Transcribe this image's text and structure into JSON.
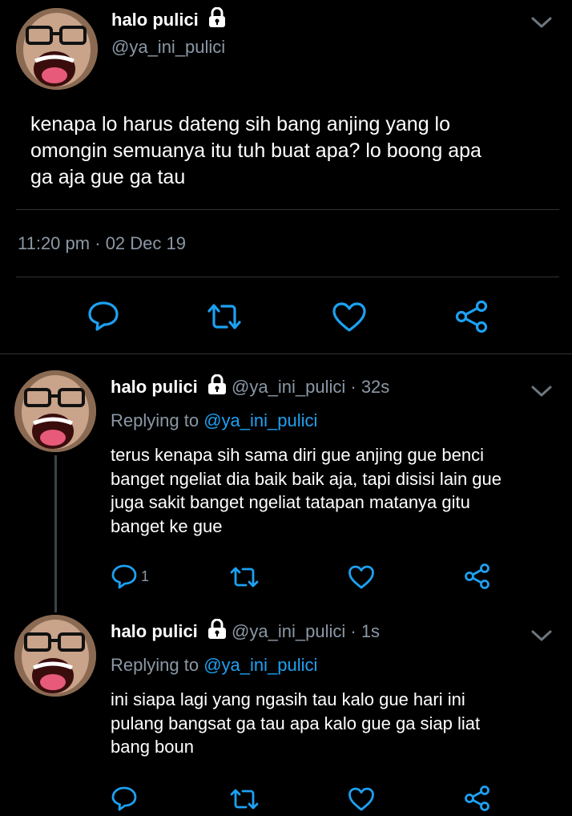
{
  "main_tweet": {
    "display_name": "halo pulici",
    "handle": "@ya_ini_pulici",
    "text_lines": [
      "kenapa lo harus dateng sih bang anjing yang lo",
      "omongin semuanya itu tuh buat apa? lo boong apa",
      "ga aja gue ga tau"
    ],
    "timestamp": "11:20 pm",
    "separator": "·",
    "date": "02 Dec 19"
  },
  "replies": [
    {
      "display_name": "halo pulici",
      "handle": "@ya_ini_pulici",
      "separator": "·",
      "age": "32s",
      "replying_prefix": "Replying to",
      "replying_to": "@ya_ini_pulici",
      "text_lines": [
        "terus kenapa sih sama diri gue anjing gue benci",
        "banget ngeliat dia baik baik aja, tapi disisi lain gue",
        "juga sakit banget ngeliat tatapan matanya gitu",
        "banget ke gue"
      ],
      "reply_count": "1"
    },
    {
      "display_name": "halo pulici",
      "handle": "@ya_ini_pulici",
      "separator": "·",
      "age": "1s",
      "replying_prefix": "Replying to",
      "replying_to": "@ya_ini_pulici",
      "text_lines": [
        "ini siapa lagi yang ngasih tau kalo gue hari ini",
        "pulang bangsat ga tau apa kalo gue ga siap liat",
        "bang boun"
      ],
      "reply_count": ""
    }
  ],
  "colors": {
    "background": "#000000",
    "muted": "#8b98a5",
    "link": "#1da1f2",
    "divider": "#2f3336",
    "icon": "#1da1f2"
  },
  "icons": [
    "lock-icon",
    "chevron-down-icon",
    "reply-icon",
    "retweet-icon",
    "like-icon",
    "share-icon"
  ]
}
